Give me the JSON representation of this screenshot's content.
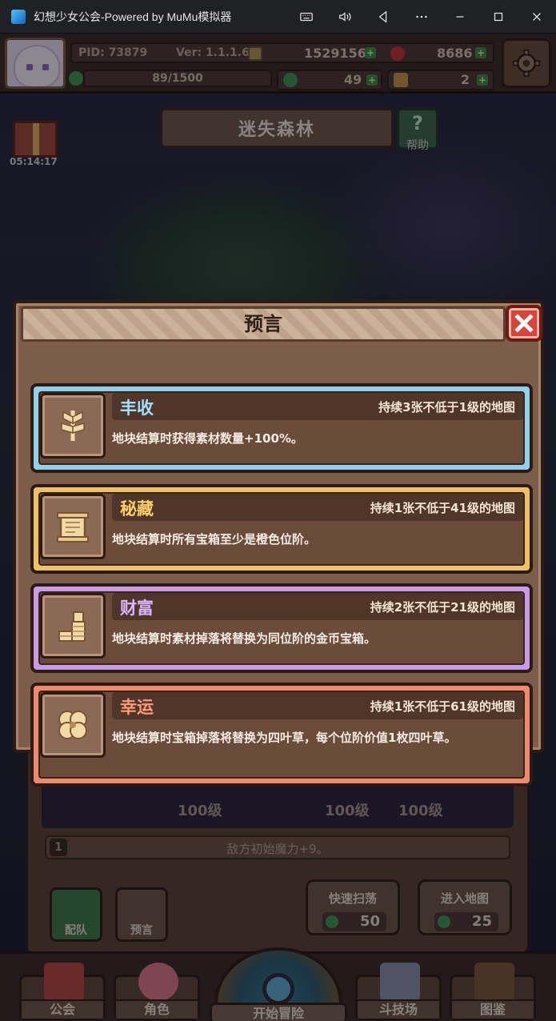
{
  "window": {
    "title": "幻想少女公会-Powered by MuMu模拟器"
  },
  "hud": {
    "pid": "PID: 73879",
    "version": "Ver: 1.1.1.6",
    "gold": "1529156",
    "gems": "8686",
    "stamina": "89/1500",
    "clovers": "49",
    "keys": "2"
  },
  "map": {
    "title": "迷失森林",
    "help_label": "帮助",
    "gift_timer": "05:14:17"
  },
  "modal": {
    "title": "预言",
    "prophecies": [
      {
        "name": "丰收",
        "condition": "持续3张不低于1级的地图",
        "description": "地块结算时获得素材数量+100%。",
        "icon": "wheat-icon"
      },
      {
        "name": "秘藏",
        "condition": "持续1张不低于41级的地图",
        "description": "地块结算时所有宝箱至少是橙色位阶。",
        "icon": "scroll-icon"
      },
      {
        "name": "财富",
        "condition": "持续2张不低于21级的地图",
        "description": "地块结算时素材掉落将替换为同位阶的金币宝箱。",
        "icon": "coin-stack-icon"
      },
      {
        "name": "幸运",
        "condition": "持续1张不低于61级的地图",
        "description": "地块结算时宝箱掉落将替换为四叶草，每个位阶价值1枚四叶草。",
        "icon": "four-leaf-clover-icon"
      }
    ]
  },
  "under": {
    "levels": [
      "100级",
      "100级",
      "100级"
    ],
    "affix_num": "1",
    "affix_text": "敌方初始魔力+9。",
    "team_label": "配队",
    "prophecy_label": "预言",
    "sweep_label": "快速扫荡",
    "sweep_cost": "50",
    "enter_label": "进入地图",
    "enter_cost": "25"
  },
  "nav": {
    "guild": "公会",
    "character": "角色",
    "adventure": "开始冒险",
    "arena": "斗技场",
    "codex": "图鉴"
  },
  "colors": {
    "harvest": "#8fd0ea",
    "treasure": "#f0c066",
    "wealth": "#c79be8",
    "luck": "#f08a6e",
    "close": "#d8443a"
  }
}
